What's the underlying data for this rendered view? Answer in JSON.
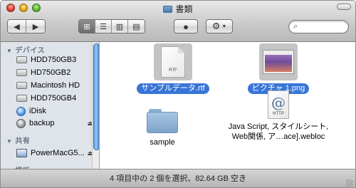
{
  "window": {
    "title": "書類",
    "colors": {
      "selection": "#3875d7",
      "sidebar_bg": "#dee4ea"
    }
  },
  "toolbar": {
    "back_icon": "arrow-left-icon",
    "forward_icon": "arrow-right-icon",
    "view_modes": [
      "icon-view",
      "list-view",
      "column-view",
      "coverflow-view"
    ],
    "active_view": "icon-view",
    "quicklook_icon": "eye-icon",
    "action_icon": "gear-icon",
    "search_placeholder": ""
  },
  "sidebar": {
    "sections": [
      {
        "header": "デバイス",
        "items": [
          {
            "label": "HDD750GB3",
            "icon": "hard-drive-icon",
            "eject": false
          },
          {
            "label": "HD750GB2",
            "icon": "hard-drive-icon",
            "eject": false
          },
          {
            "label": "Macintosh HD",
            "icon": "hard-drive-icon",
            "eject": false
          },
          {
            "label": "HDD750GB4",
            "icon": "hard-drive-icon",
            "eject": false
          },
          {
            "label": "iDisk",
            "icon": "idisk-icon",
            "eject": false
          },
          {
            "label": "backup",
            "icon": "backup-disk-icon",
            "eject": true
          }
        ]
      },
      {
        "header": "共有",
        "items": [
          {
            "label": "PowerMacG5...",
            "icon": "computer-icon",
            "eject": true
          }
        ]
      },
      {
        "header": "場所",
        "items": []
      }
    ]
  },
  "files": [
    {
      "name": "サンプルデータ.rtf",
      "icon": "rtf-document-icon",
      "badge": "RTF",
      "selected": true
    },
    {
      "name": "ピクチャ 1.png",
      "icon": "png-image-icon",
      "selected": true
    },
    {
      "name": "sample",
      "icon": "folder-icon",
      "selected": false
    },
    {
      "name_line1": "Java Script, スタイルシート,",
      "name_line2": "Web関係, ア…ace].webloc",
      "icon": "webloc-icon",
      "badge": "HTTP",
      "selected": false
    }
  ],
  "statusbar": {
    "text": "4 項目中の 2 個を選択、82.64 GB 空き"
  }
}
